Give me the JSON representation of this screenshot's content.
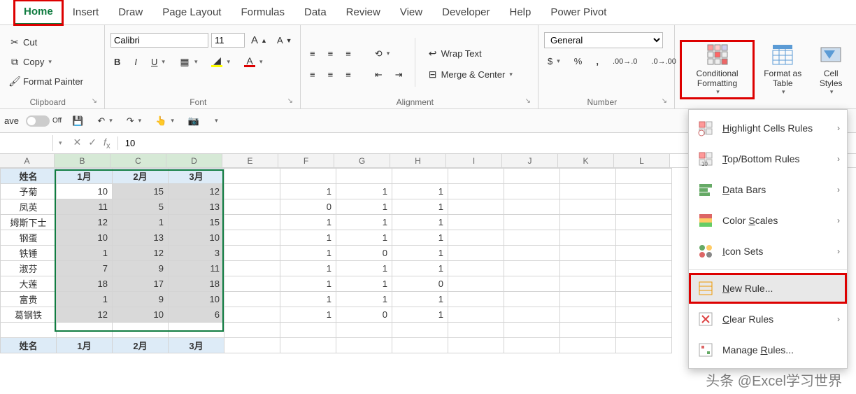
{
  "tabs": [
    "Home",
    "Insert",
    "Draw",
    "Page Layout",
    "Formulas",
    "Data",
    "Review",
    "View",
    "Developer",
    "Help",
    "Power Pivot"
  ],
  "clipboard": {
    "cut": "Cut",
    "copy": "Copy",
    "painter": "Format Painter",
    "label": "Clipboard"
  },
  "font": {
    "name": "Calibri",
    "size": "11",
    "label": "Font"
  },
  "alignment": {
    "wrap": "Wrap Text",
    "merge": "Merge & Center",
    "label": "Alignment"
  },
  "number": {
    "format": "General",
    "label": "Number"
  },
  "styles": {
    "cf": "Conditional Formatting",
    "table": "Format as Table",
    "cell": "Cell Styles"
  },
  "qat": {
    "autosave": "ave",
    "off": "Off"
  },
  "fx": {
    "namebox": "",
    "value": "10"
  },
  "cols": [
    "A",
    "B",
    "C",
    "D",
    "E",
    "F",
    "G",
    "H",
    "I",
    "J",
    "K",
    "L"
  ],
  "headers": {
    "A": "姓名",
    "B": "1月",
    "C": "2月",
    "D": "3月"
  },
  "rows": [
    {
      "name": "予菊",
      "b": 10,
      "c": 15,
      "d": 12,
      "f": 1,
      "g": 1,
      "h": 1
    },
    {
      "name": "凤英",
      "b": 11,
      "c": 5,
      "d": 13,
      "f": 0,
      "g": 1,
      "h": 1
    },
    {
      "name": "姆斯下士",
      "b": 12,
      "c": 1,
      "d": 15,
      "f": 1,
      "g": 1,
      "h": 1
    },
    {
      "name": "钢蛋",
      "b": 10,
      "c": 13,
      "d": 10,
      "f": 1,
      "g": 1,
      "h": 1
    },
    {
      "name": "铁锤",
      "b": 1,
      "c": 12,
      "d": 3,
      "f": 1,
      "g": 0,
      "h": 1
    },
    {
      "name": "淑芬",
      "b": 7,
      "c": 9,
      "d": 11,
      "f": 1,
      "g": 1,
      "h": 1
    },
    {
      "name": "大莲",
      "b": 18,
      "c": 17,
      "d": 18,
      "f": 1,
      "g": 1,
      "h": 0
    },
    {
      "name": "富贵",
      "b": 1,
      "c": 9,
      "d": 10,
      "f": 1,
      "g": 1,
      "h": 1
    },
    {
      "name": "葛钢铁",
      "b": 12,
      "c": 10,
      "d": 6,
      "f": 1,
      "g": 0,
      "h": 1
    }
  ],
  "headers2": {
    "A": "姓名",
    "B": "1月",
    "C": "2月",
    "D": "3月"
  },
  "cf_menu": [
    {
      "label": "Highlight Cells Rules",
      "u": "H",
      "sub": true
    },
    {
      "label": "Top/Bottom Rules",
      "u": "T",
      "sub": true
    },
    {
      "label": "Data Bars",
      "u": "D",
      "sub": true
    },
    {
      "label": "Color Scales",
      "u": "S",
      "sub": true
    },
    {
      "label": "Icon Sets",
      "u": "I",
      "sub": true
    },
    {
      "label": "New Rule...",
      "u": "N",
      "sub": false,
      "hl": true
    },
    {
      "label": "Clear Rules",
      "u": "C",
      "sub": true
    },
    {
      "label": "Manage Rules...",
      "u": "R",
      "sub": false
    }
  ],
  "watermark": "头条 @Excel学习世界"
}
